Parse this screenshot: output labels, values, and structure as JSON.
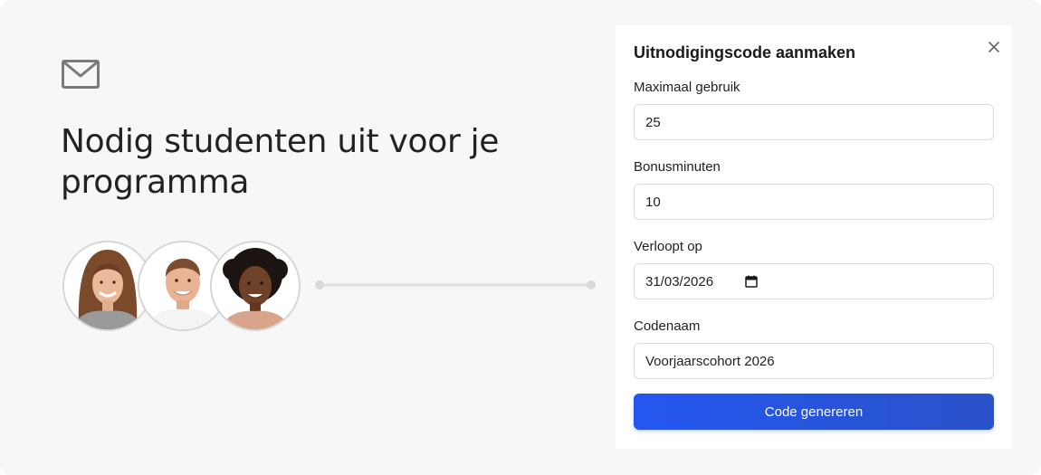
{
  "hero": {
    "headline": "Nodig studenten uit voor je programma",
    "icon": "envelope-icon",
    "avatars": [
      "avatar-student-1",
      "avatar-student-2",
      "avatar-student-3"
    ]
  },
  "modal": {
    "title": "Uitnodigingscode aanmaken",
    "close_icon": "close-icon",
    "fields": {
      "max_use": {
        "label": "Maximaal gebruik",
        "value": "25"
      },
      "bonus": {
        "label": "Bonusminuten",
        "value": "10"
      },
      "expires": {
        "label": "Verloopt op",
        "value": "31/03/2026",
        "icon": "calendar-icon"
      },
      "code_name": {
        "label": "Codenaam",
        "value": "Voorjaarscohort 2026"
      }
    },
    "submit_label": "Code genereren"
  },
  "colors": {
    "background": "#f7f7f7",
    "panel": "#ffffff",
    "accent": "#2457f0",
    "text": "#222222"
  }
}
